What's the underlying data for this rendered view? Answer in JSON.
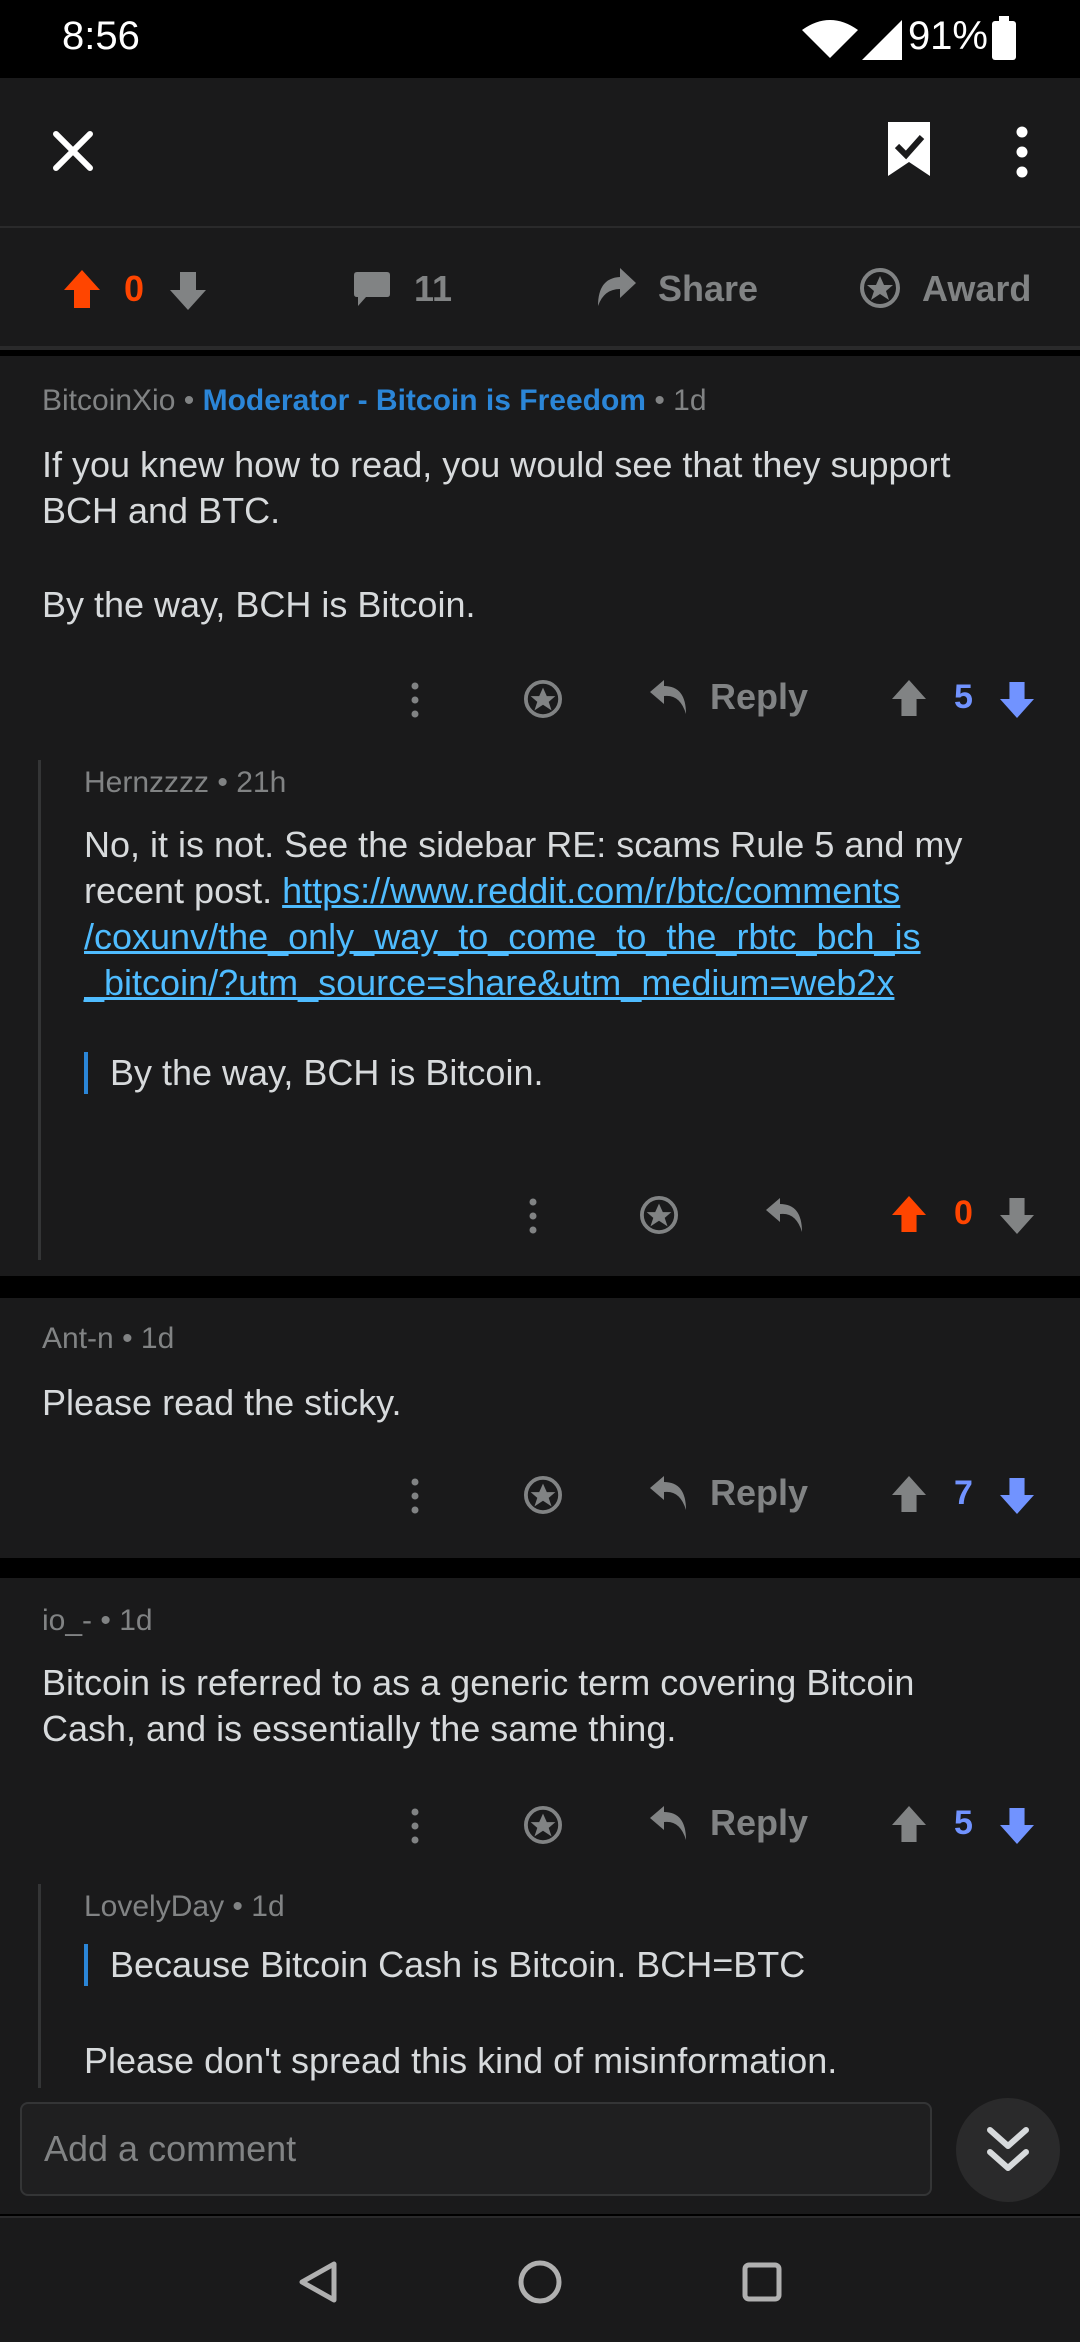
{
  "status_bar": {
    "time": "8:56",
    "battery": "91%"
  },
  "post_actions": {
    "score": "0",
    "comments": "11",
    "share_label": "Share",
    "award_label": "Award"
  },
  "comments": [
    {
      "author": "BitcoinXio",
      "flair": "Moderator - Bitcoin is Freedom",
      "age": "1d",
      "body_lines": [
        "If you knew how to read, you would see that they support",
        "BCH and BTC."
      ],
      "body_para2": "By the way, BCH is Bitcoin.",
      "reply_label": "Reply",
      "score": "5"
    },
    {
      "author": "Hernzzzz",
      "age": "21h",
      "body_line1": "No, it is not. See the sidebar RE: scams Rule 5 and my",
      "body_line2_prefix": "recent post. ",
      "link_lines": [
        "https://www.reddit.com/r/btc/comments",
        "/coxunv/the_only_way_to_come_to_the_rbtc_bch_is",
        "_bitcoin/?utm_source=share&utm_medium=web2x"
      ],
      "quote": "By the way, BCH is Bitcoin.",
      "score": "0"
    },
    {
      "author": "Ant-n",
      "age": "1d",
      "body": "Please read the sticky.",
      "reply_label": "Reply",
      "score": "7"
    },
    {
      "author": "io_-",
      "age": "1d",
      "body_lines": [
        "Bitcoin is referred to as a generic term covering Bitcoin",
        "Cash, and is essentially the same thing."
      ],
      "reply_label": "Reply",
      "score": "5"
    },
    {
      "author": "LovelyDay",
      "age": "1d",
      "quote": "Because Bitcoin Cash is Bitcoin. BCH=BTC",
      "body": "Please don't spread this kind of misinformation."
    }
  ],
  "composer": {
    "placeholder": "Add a comment"
  },
  "icons": {
    "close": "close-icon",
    "saved": "bookmark-check-icon",
    "more": "more-vertical-icon",
    "upvote": "arrow-up-icon",
    "downvote": "arrow-down-icon",
    "comment": "comment-icon",
    "share": "share-icon",
    "award": "award-icon",
    "reply": "reply-icon",
    "collapse": "double-chevron-down-icon",
    "back": "back-icon",
    "home": "home-icon",
    "recents": "recents-icon"
  },
  "colors": {
    "upvoted": "#ff4500",
    "downvoted": "#7193ff",
    "link": "#4fbcff",
    "flair": "#2b86d8"
  }
}
